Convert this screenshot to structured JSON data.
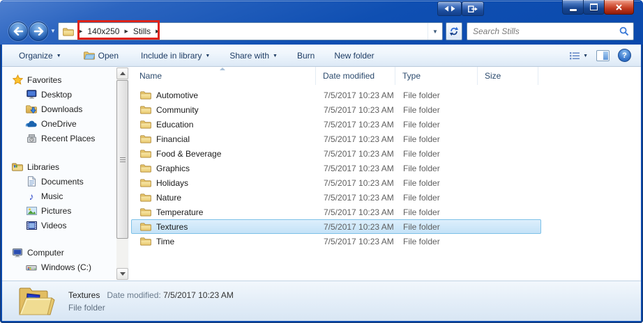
{
  "icons": {
    "breadcrumb_chevron": "▶",
    "dropdown_caret": "▼",
    "nav_caret": "▼",
    "toolbar_caret": "▼",
    "music_note": "♪",
    "help": "?"
  },
  "address_bar": {
    "breadcrumb": {
      "segments": [
        "140x250",
        "Stills"
      ]
    },
    "search": {
      "placeholder": "Search Stills"
    }
  },
  "toolbar": {
    "organize": "Organize",
    "open": "Open",
    "include": "Include in library",
    "share": "Share with",
    "burn": "Burn",
    "new_folder": "New folder"
  },
  "sidebar": {
    "sections": [
      {
        "label": "Favorites",
        "items": [
          {
            "label": "Desktop"
          },
          {
            "label": "Downloads"
          },
          {
            "label": "OneDrive"
          },
          {
            "label": "Recent Places"
          }
        ]
      },
      {
        "label": "Libraries",
        "items": [
          {
            "label": "Documents"
          },
          {
            "label": "Music"
          },
          {
            "label": "Pictures"
          },
          {
            "label": "Videos"
          }
        ]
      },
      {
        "label": "Computer",
        "items": [
          {
            "label": "Windows (C:)"
          }
        ]
      }
    ]
  },
  "file_list": {
    "columns": [
      "Name",
      "Date modified",
      "Type",
      "Size"
    ],
    "rows": [
      {
        "name": "Automotive",
        "date": "7/5/2017 10:23 AM",
        "type": "File folder",
        "size": "",
        "selected": false
      },
      {
        "name": "Community",
        "date": "7/5/2017 10:23 AM",
        "type": "File folder",
        "size": "",
        "selected": false
      },
      {
        "name": "Education",
        "date": "7/5/2017 10:23 AM",
        "type": "File folder",
        "size": "",
        "selected": false
      },
      {
        "name": "Financial",
        "date": "7/5/2017 10:23 AM",
        "type": "File folder",
        "size": "",
        "selected": false
      },
      {
        "name": "Food & Beverage",
        "date": "7/5/2017 10:23 AM",
        "type": "File folder",
        "size": "",
        "selected": false
      },
      {
        "name": "Graphics",
        "date": "7/5/2017 10:23 AM",
        "type": "File folder",
        "size": "",
        "selected": false
      },
      {
        "name": "Holidays",
        "date": "7/5/2017 10:23 AM",
        "type": "File folder",
        "size": "",
        "selected": false
      },
      {
        "name": "Nature",
        "date": "7/5/2017 10:23 AM",
        "type": "File folder",
        "size": "",
        "selected": false
      },
      {
        "name": "Temperature",
        "date": "7/5/2017 10:23 AM",
        "type": "File folder",
        "size": "",
        "selected": false
      },
      {
        "name": "Textures",
        "date": "7/5/2017 10:23 AM",
        "type": "File folder",
        "size": "",
        "selected": true
      },
      {
        "name": "Time",
        "date": "7/5/2017 10:23 AM",
        "type": "File folder",
        "size": "",
        "selected": false
      }
    ]
  },
  "details_pane": {
    "name": "Textures",
    "date_label": "Date modified:",
    "date_value": "7/5/2017 10:23 AM",
    "type": "File folder"
  },
  "colors": {
    "titlebar_blue": "#0a49ac",
    "highlight_red": "#e02318",
    "selection_border": "#7dc1e8",
    "selection_fill": "#c4e2f7",
    "close_button_red": "#c23a20"
  }
}
